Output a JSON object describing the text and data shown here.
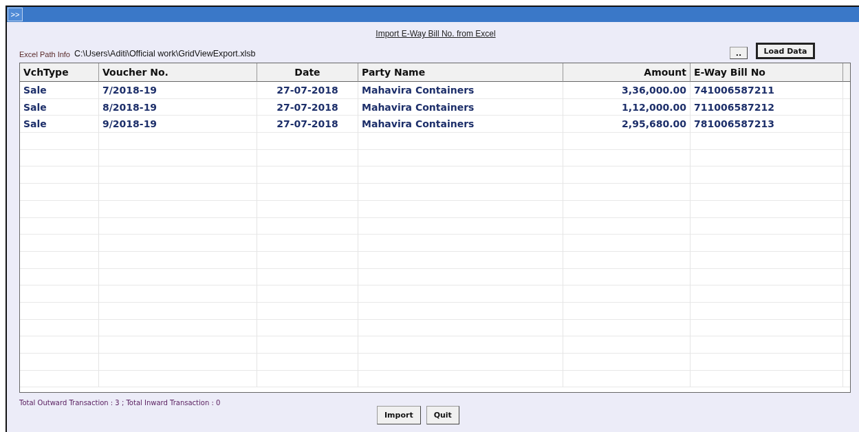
{
  "window": {
    "title_button": ">>"
  },
  "heading": "Import E-Way Bill No. from Excel",
  "path": {
    "label": "Excel Path Info",
    "value": "C:\\Users\\Aditi\\Official work\\GridViewExport.xlsb"
  },
  "toolbar_buttons": [
    {
      "label": "..",
      "kind": "browse"
    },
    {
      "label": "Load Data",
      "kind": "default"
    }
  ],
  "table": {
    "columns": [
      "VchType",
      "Voucher No.",
      "Date",
      "Party Name",
      "Amount",
      "E-Way Bill No"
    ],
    "rows": [
      [
        "Sale",
        "7/2018-19",
        "27-07-2018",
        "Mahavira Containers",
        "3,36,000.00",
        "741006587211"
      ],
      [
        "Sale",
        "8/2018-19",
        "27-07-2018",
        "Mahavira Containers",
        "1,12,000.00",
        "711006587212"
      ],
      [
        "Sale",
        "9/2018-19",
        "27-07-2018",
        "Mahavira Containers",
        "2,95,680.00",
        "781006587213"
      ]
    ]
  },
  "status": "Total Outward Transaction : 3 ; Total Inward Transaction : 0",
  "buttons": [
    "Import",
    "Quit"
  ]
}
